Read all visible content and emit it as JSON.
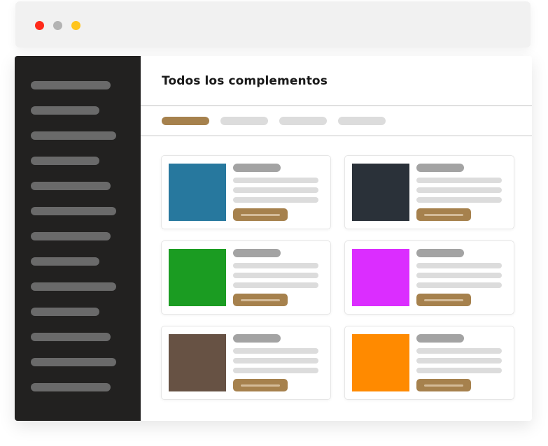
{
  "window_controls": [
    {
      "name": "close",
      "color": "#ff2a1a"
    },
    {
      "name": "minimize",
      "color": "#b3b3b3"
    },
    {
      "name": "maximize",
      "color": "#ffc51e"
    }
  ],
  "colors": {
    "sidebar_bg": "#222120",
    "sidebar_item": "#6a6a6a",
    "accent": "#a6814d",
    "accent_line": "#d4bb98",
    "placeholder_title": "#a3a3a3",
    "placeholder_line": "#dcdcdc",
    "tab_inactive": "#dcdcdc"
  },
  "sidebar": {
    "item_count": 13
  },
  "main": {
    "title": "Todos los complementos",
    "tabs": [
      {
        "active": true
      },
      {
        "active": false
      },
      {
        "active": false
      },
      {
        "active": false
      }
    ],
    "plugins": [
      {
        "thumb_color": "#27789e"
      },
      {
        "thumb_color": "#2a3139"
      },
      {
        "thumb_color": "#1b9c22"
      },
      {
        "thumb_color": "#db2dff"
      },
      {
        "thumb_color": "#675244"
      },
      {
        "thumb_color": "#ff8a00"
      }
    ]
  }
}
